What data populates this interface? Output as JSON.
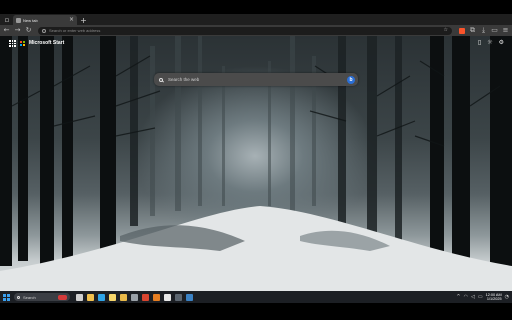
{
  "browser": {
    "tab": {
      "title": "New tab",
      "close_icon": "close-icon"
    },
    "new_tab_label": "+",
    "address": {
      "placeholder": "Search or enter web address"
    },
    "toolbar_icons": {
      "back": "arrow-left-icon",
      "forward": "arrow-right-icon",
      "reload": "reload-icon",
      "extensions": "puzzle-icon",
      "menu": "menu-icon"
    }
  },
  "page": {
    "brand": "Microsoft Start",
    "search_placeholder": "Search the web",
    "header_icons": [
      "phone-icon",
      "light-bulb-icon",
      "settings-icon"
    ]
  },
  "taskbar": {
    "search_placeholder": "Search",
    "apps": [
      {
        "name": "task-view",
        "color": "#d0d0d0"
      },
      {
        "name": "file-explorer",
        "color": "#f2c14e"
      },
      {
        "name": "edge",
        "color": "#2fa4e7"
      },
      {
        "name": "notes",
        "color": "#f7d66a"
      },
      {
        "name": "folder",
        "color": "#e9b949"
      },
      {
        "name": "app-gray",
        "color": "#9aa1a8"
      },
      {
        "name": "app-red",
        "color": "#d9452f"
      },
      {
        "name": "app-orange",
        "color": "#e67e22"
      },
      {
        "name": "app-white",
        "color": "#e8e8e8"
      },
      {
        "name": "app-dark",
        "color": "#5c6670"
      },
      {
        "name": "app-blue",
        "color": "#3b82c4"
      }
    ],
    "clock": {
      "time": "12:00 AM",
      "date": "1/1/2025"
    }
  },
  "colors": {
    "accent": "#2b6fd6",
    "start": "#3aa0f0",
    "brave": "#fb542b"
  }
}
